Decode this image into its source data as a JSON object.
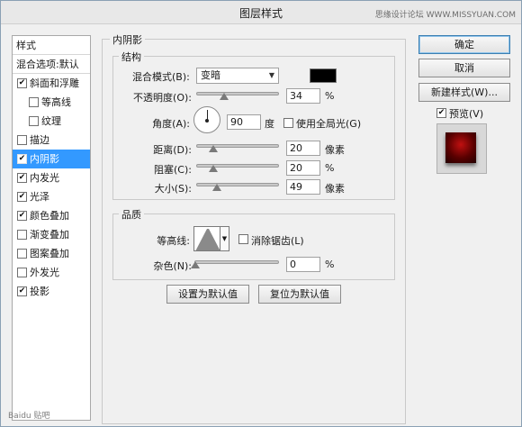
{
  "window": {
    "title": "图层样式",
    "watermark": "思缘设计论坛 WWW.MISSYUAN.COM"
  },
  "left_list": {
    "header_styles": "样式",
    "header_blend": "混合选项:默认",
    "items": [
      {
        "label": "斜面和浮雕",
        "checked": true,
        "indent": false,
        "selected": false
      },
      {
        "label": "等高线",
        "checked": false,
        "indent": true,
        "selected": false
      },
      {
        "label": "纹理",
        "checked": false,
        "indent": true,
        "selected": false
      },
      {
        "label": "描边",
        "checked": false,
        "indent": false,
        "selected": false
      },
      {
        "label": "内阴影",
        "checked": true,
        "indent": false,
        "selected": true
      },
      {
        "label": "内发光",
        "checked": true,
        "indent": false,
        "selected": false
      },
      {
        "label": "光泽",
        "checked": true,
        "indent": false,
        "selected": false
      },
      {
        "label": "颜色叠加",
        "checked": true,
        "indent": false,
        "selected": false
      },
      {
        "label": "渐变叠加",
        "checked": false,
        "indent": false,
        "selected": false
      },
      {
        "label": "图案叠加",
        "checked": false,
        "indent": false,
        "selected": false
      },
      {
        "label": "外发光",
        "checked": false,
        "indent": false,
        "selected": false
      },
      {
        "label": "投影",
        "checked": true,
        "indent": false,
        "selected": false
      }
    ]
  },
  "panel": {
    "title": "内阴影",
    "structure": {
      "title": "结构",
      "blend_mode_label": "混合模式(B):",
      "blend_mode_value": "变暗",
      "blend_color": "#000000",
      "opacity_label": "不透明度(O):",
      "opacity_value": "34",
      "opacity_unit": "%",
      "angle_label": "角度(A):",
      "angle_value": "90",
      "angle_unit": "度",
      "global_light_label": "使用全局光(G)",
      "global_light_checked": false,
      "distance_label": "距离(D):",
      "distance_value": "20",
      "distance_unit": "像素",
      "choke_label": "阻塞(C):",
      "choke_value": "20",
      "choke_unit": "%",
      "size_label": "大小(S):",
      "size_value": "49",
      "size_unit": "像素"
    },
    "quality": {
      "title": "品质",
      "contour_label": "等高线:",
      "antialias_label": "消除锯齿(L)",
      "antialias_checked": false,
      "noise_label": "杂色(N):",
      "noise_value": "0",
      "noise_unit": "%"
    },
    "buttons": {
      "set_default": "设置为默认值",
      "reset_default": "复位为默认值"
    }
  },
  "right": {
    "ok": "确定",
    "cancel": "取消",
    "new_style": "新建样式(W)...",
    "preview_label": "预览(V)",
    "preview_checked": true
  },
  "baidu_watermark": "Baidu 贴吧"
}
